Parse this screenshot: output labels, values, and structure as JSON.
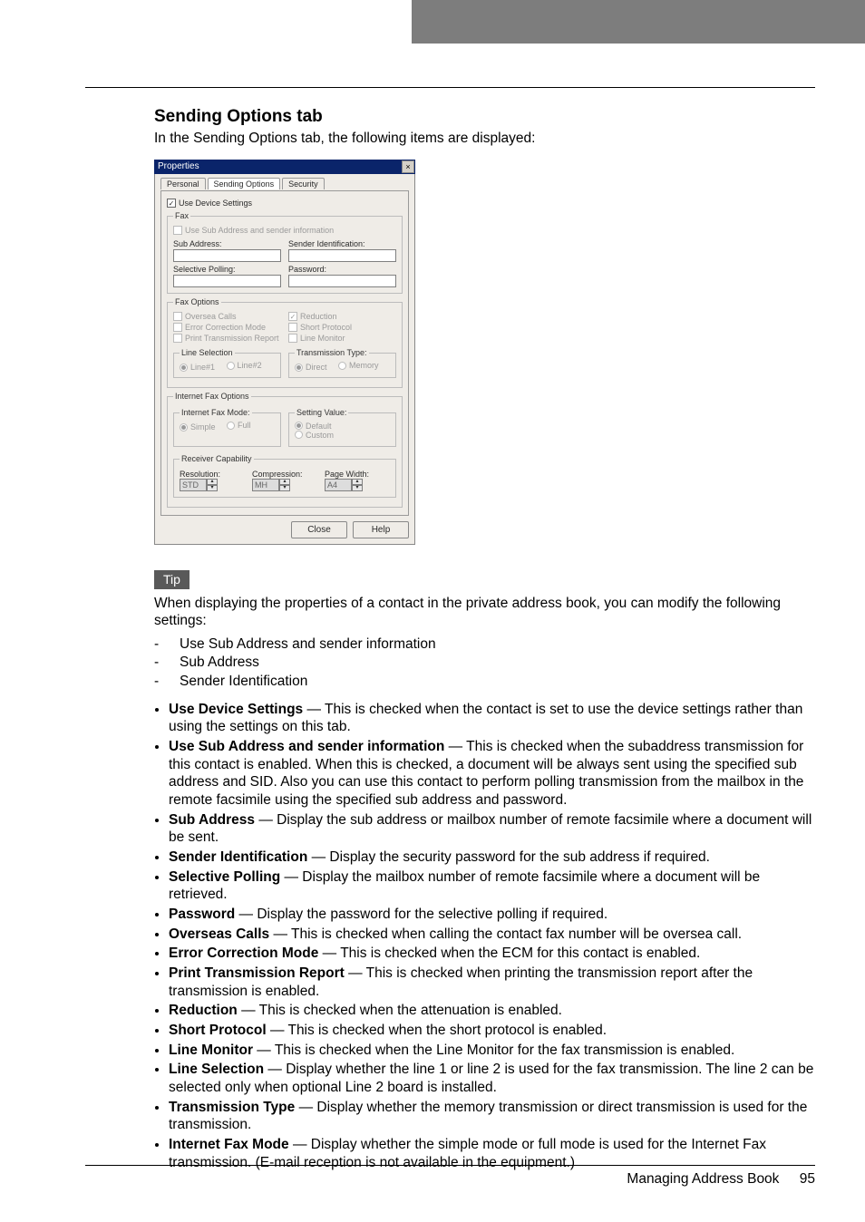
{
  "section": {
    "heading": "Sending Options tab",
    "intro": "In the Sending Options tab, the following items are displayed:"
  },
  "dialog": {
    "title": "Properties",
    "tabs": [
      "Personal",
      "Sending Options",
      "Security"
    ],
    "use_device": "Use Device Settings",
    "fax_legend": "Fax",
    "use_sub_sender": "Use Sub Address and sender information",
    "sub_address": "Sub Address:",
    "sender_id": "Sender Identification:",
    "sel_polling": "Selective Polling:",
    "password": "Password:",
    "fax_options_legend": "Fax Options",
    "overseas": "Oversea Calls",
    "ecm": "Error Correction Mode",
    "ptr": "Print Transmission Report",
    "reduction": "Reduction",
    "short_proto": "Short Protocol",
    "line_monitor": "Line Monitor",
    "line_sel_legend": "Line Selection",
    "line1": "Line#1",
    "line2": "Line#2",
    "tx_type_legend": "Transmission Type:",
    "direct": "Direct",
    "memory": "Memory",
    "ifax_legend": "Internet Fax Options",
    "ifax_mode_legend": "Internet Fax Mode:",
    "simple": "Simple",
    "full": "Full",
    "setting_val_legend": "Setting Value:",
    "default": "Default",
    "custom": "Custom",
    "rcvcap_legend": "Receiver Capability",
    "resolution": "Resolution:",
    "res_val": "STD",
    "compression": "Compression:",
    "comp_val": "MH",
    "page_width": "Page Width:",
    "pw_val": "A4",
    "close": "Close",
    "help": "Help"
  },
  "tip": {
    "label": "Tip",
    "para": "When displaying the properties of a contact in the private address book, you can modify the following settings:",
    "items": [
      "Use Sub Address and sender information",
      "Sub Address",
      "Sender Identification"
    ]
  },
  "defs": [
    {
      "t": "Use Device Settings",
      "d": " — This is checked when the contact is set to use the device settings rather than using the settings on this tab."
    },
    {
      "t": "Use Sub Address and sender information",
      "d": " — This is checked when the subaddress transmission for this contact is enabled. When this is checked, a document will be always sent using the specified sub address and SID. Also you can use this contact to perform polling transmission from the mailbox in the remote facsimile using the specified sub address and password."
    },
    {
      "t": "Sub Address",
      "d": " — Display the sub address or mailbox number of remote facsimile where a document will be sent."
    },
    {
      "t": "Sender Identification",
      "d": " — Display the security password for the sub address if required."
    },
    {
      "t": "Selective Polling",
      "d": " — Display the mailbox number of remote facsimile where a document will be retrieved."
    },
    {
      "t": "Password",
      "d": " — Display the password for the selective polling if required."
    },
    {
      "t": "Overseas Calls",
      "d": " — This is checked when calling the contact fax number will be oversea call."
    },
    {
      "t": "Error Correction Mode",
      "d": " — This is checked when the ECM for this contact is enabled."
    },
    {
      "t": "Print Transmission Report",
      "d": " — This is checked when printing the transmission report after the transmission is enabled."
    },
    {
      "t": "Reduction",
      "d": " — This is checked when the attenuation is enabled."
    },
    {
      "t": "Short Protocol",
      "d": " — This is checked when the short protocol is enabled."
    },
    {
      "t": "Line Monitor",
      "d": " — This is checked when the Line Monitor for the fax transmission is enabled."
    },
    {
      "t": "Line Selection",
      "d": " — Display whether the line 1 or line 2 is used for the fax transmission. The line 2 can be selected only when optional Line 2 board is installed."
    },
    {
      "t": "Transmission Type",
      "d": " — Display whether the memory transmission or direct transmission is used for the transmission."
    },
    {
      "t": "Internet Fax Mode",
      "d": " — Display whether the simple mode or full mode is used for the Internet Fax transmission. (E-mail reception is not available in the equipment.)"
    }
  ],
  "footer": {
    "text": "Managing Address Book",
    "page": "95"
  }
}
